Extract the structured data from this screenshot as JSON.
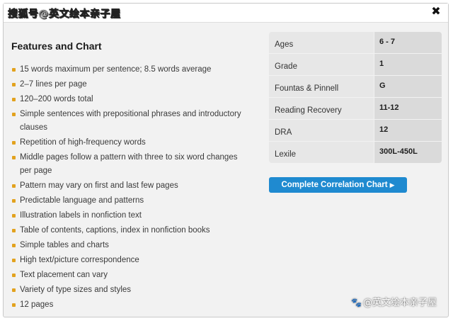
{
  "watermark_top": "搜狐号@英文绘本亲子屋",
  "close_glyph": "✖",
  "heading": "Features and Chart",
  "features": [
    "15 words maximum per sentence; 8.5 words average",
    "2–7 lines per page",
    "120–200 words total",
    "Simple sentences with prepositional phrases and introductory clauses",
    "Repetition of high-frequency words",
    "Middle pages follow a pattern with three to six word changes per page",
    "Pattern may vary on first and last few pages",
    "Predictable language and patterns",
    "Illustration labels in nonfiction text",
    "Table of contents, captions, index in nonfiction books",
    "Simple tables and charts",
    "High text/picture correspondence",
    "Text placement can vary",
    "Variety of type sizes and styles",
    "12 pages"
  ],
  "levels": [
    {
      "label": "Ages",
      "value": "6 - 7"
    },
    {
      "label": "Grade",
      "value": "1"
    },
    {
      "label": "Fountas & Pinnell",
      "value": "G"
    },
    {
      "label": "Reading Recovery",
      "value": "11-12"
    },
    {
      "label": "DRA",
      "value": "12"
    },
    {
      "label": "Lexile",
      "value": "300L-450L"
    }
  ],
  "cta_label": "Complete Correlation Chart",
  "cta_chevron": "▶",
  "watermark_bottom": "@英文绘本亲子屋",
  "colors": {
    "accent": "#1f8ad0",
    "bullet": "#e2a21e"
  }
}
